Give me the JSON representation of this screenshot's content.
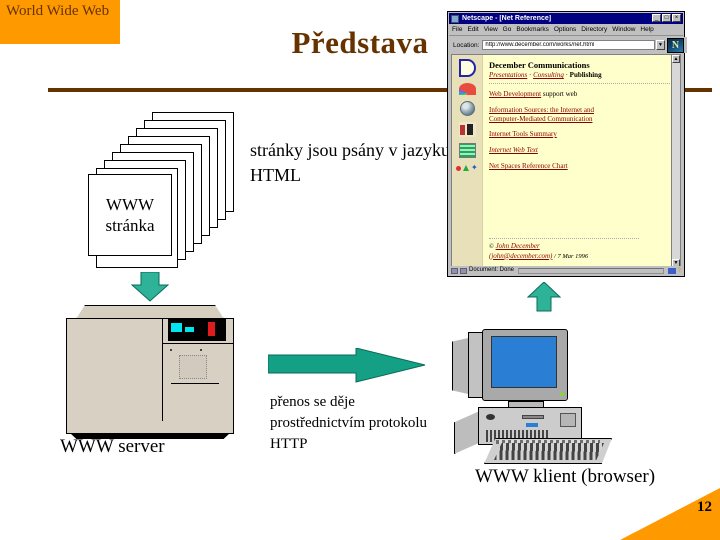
{
  "header": {
    "banner_text": "World Wide Web",
    "title": "Představa",
    "banner_color": "#FF9900",
    "title_color": "#663300"
  },
  "diagram": {
    "page_stack_label_line1": "WWW",
    "page_stack_label_line2": "stránka",
    "html_note": "stránky jsou psány v jazyku HTML",
    "server_label": "WWW server",
    "client_label": "WWW klient (browser)",
    "http_note": "přenos se děje prostřednictvím protokolu HTTP",
    "arrow_color": "#2EB398",
    "arrow_down_name": "arrow-down",
    "arrow_up_name": "arrow-up",
    "arrow_right_name": "arrow-right"
  },
  "browser": {
    "title": "Netscape - [Net Reference]",
    "window_buttons": [
      "_",
      "□",
      "×"
    ],
    "menus": [
      "File",
      "Edit",
      "View",
      "Go",
      "Bookmarks",
      "Options",
      "Directory",
      "Window",
      "Help"
    ],
    "location_label": "Location:",
    "url": "http://www.december.com/works/net.html",
    "logo_letter": "N",
    "page": {
      "heading": "December Communications",
      "subtitle_items": [
        "Presentations",
        "Consulting",
        "Publishing"
      ],
      "subtitle_separator": " · ",
      "links": [
        "Web Development",
        "Information Sources: the Internet and",
        "Computer-Mediated Communication",
        "Internet Tools Summary",
        "Internet Web Text",
        "Net Spaces Reference Chart"
      ],
      "web_dev_suffix": " support web",
      "copyright_symbol": "©",
      "author": "John December",
      "email": "(john@december.com)",
      "date": "/ 7 Mar 1996"
    },
    "status": "Document: Done",
    "icons": [
      "december-d-logo-icon",
      "umbrella-icon",
      "globe-icon",
      "people-icon",
      "grid-icon",
      "bullets-icon"
    ]
  },
  "footer": {
    "page_number": "12",
    "corner_color": "#FF9900"
  }
}
